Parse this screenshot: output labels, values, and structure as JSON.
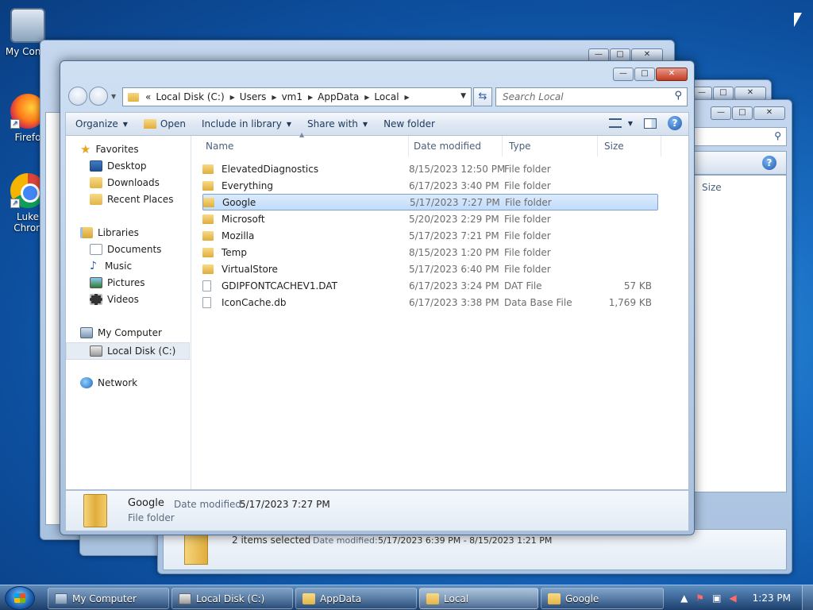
{
  "desktop": {
    "icons": [
      {
        "label": "My Comp",
        "icon": "computer-icon"
      },
      {
        "label": "Firefo",
        "icon": "firefox-icon"
      },
      {
        "label": "Luke\nChron",
        "line1": "Luke",
        "line2": "Chron",
        "icon": "chrome-icon"
      }
    ]
  },
  "back_window": {
    "status_text": "2 items selected",
    "date_label": "Date modified:",
    "date_value": "5/17/2023 6:39 PM - 8/15/2023 1:21 PM",
    "size_header": "Size"
  },
  "window": {
    "caption": {
      "minimize": "—",
      "maximize": "□",
      "close": "✕"
    },
    "address": {
      "prefix": "«",
      "crumbs": [
        "Local Disk (C:)",
        "Users",
        "vm1",
        "AppData",
        "Local"
      ]
    },
    "search_placeholder": "Search Local",
    "toolbar": {
      "organize": "Organize",
      "open": "Open",
      "include_in_library": "Include in library",
      "share_with": "Share with",
      "new_folder": "New folder"
    },
    "nav_pane": {
      "favorites": "Favorites",
      "desktop": "Desktop",
      "downloads": "Downloads",
      "recent_places": "Recent Places",
      "libraries": "Libraries",
      "documents": "Documents",
      "music": "Music",
      "pictures": "Pictures",
      "videos": "Videos",
      "my_computer": "My Computer",
      "local_disk": "Local Disk (C:)",
      "network": "Network"
    },
    "columns": {
      "name": "Name",
      "date": "Date modified",
      "type": "Type",
      "size": "Size"
    },
    "files": [
      {
        "name": "ElevatedDiagnostics",
        "date": "8/15/2023 12:50 PM",
        "type": "File folder",
        "size": "",
        "kind": "folder"
      },
      {
        "name": "Everything",
        "date": "6/17/2023 3:40 PM",
        "type": "File folder",
        "size": "",
        "kind": "folder"
      },
      {
        "name": "Google",
        "date": "5/17/2023 7:27 PM",
        "type": "File folder",
        "size": "",
        "kind": "folder",
        "selected": true
      },
      {
        "name": "Microsoft",
        "date": "5/20/2023 2:29 PM",
        "type": "File folder",
        "size": "",
        "kind": "folder"
      },
      {
        "name": "Mozilla",
        "date": "5/17/2023 7:21 PM",
        "type": "File folder",
        "size": "",
        "kind": "folder"
      },
      {
        "name": "Temp",
        "date": "8/15/2023 1:20 PM",
        "type": "File folder",
        "size": "",
        "kind": "folder"
      },
      {
        "name": "VirtualStore",
        "date": "5/17/2023 6:40 PM",
        "type": "File folder",
        "size": "",
        "kind": "folder"
      },
      {
        "name": "GDIPFONTCACHEV1.DAT",
        "date": "6/17/2023 3:24 PM",
        "type": "DAT File",
        "size": "57 KB",
        "kind": "file"
      },
      {
        "name": "IconCache.db",
        "date": "6/17/2023 3:38 PM",
        "type": "Data Base File",
        "size": "1,769 KB",
        "kind": "file"
      }
    ],
    "details": {
      "name": "Google",
      "type": "File folder",
      "date_label": "Date modified:",
      "date_value": "5/17/2023 7:27 PM"
    }
  },
  "taskbar": {
    "buttons": [
      "My Computer",
      "Local Disk (C:)",
      "AppData",
      "Local",
      "Google"
    ],
    "active_index": 3,
    "clock": "1:23 PM"
  },
  "colors": {
    "desktop_blue": "#1a6fc4",
    "selection": "#c1dcfc",
    "folder_yellow": "#e0ad3c"
  }
}
